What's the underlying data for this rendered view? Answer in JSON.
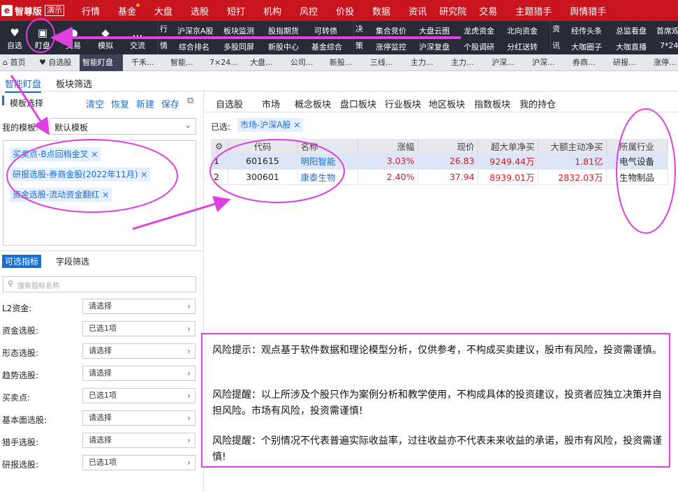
{
  "app": {
    "logo_mark": "e",
    "brand": "智尊版",
    "demo": "演示"
  },
  "top_menu": [
    "行情",
    "基金",
    "大盘",
    "选股",
    "短打",
    "机构",
    "风控",
    "价投",
    "数据",
    "资讯",
    "研究院",
    "交易",
    "主题猎手",
    "舆情猎手"
  ],
  "tool_buttons": [
    {
      "icon": "heart-icon",
      "glyph": "♥",
      "label": "自选"
    },
    {
      "icon": "chart-icon",
      "glyph": "▣",
      "label": "盯盘"
    },
    {
      "icon": "swap-icon",
      "glyph": "●",
      "label": "交易"
    },
    {
      "icon": "gamepad-icon",
      "glyph": "◆",
      "label": "模拟"
    },
    {
      "icon": "chat-icon",
      "glyph": "…",
      "label": "交流"
    }
  ],
  "groups": {
    "hang_label": "行情",
    "hang_row1": [
      "沪深京A股",
      "板块监测",
      "股指期货",
      "可转债"
    ],
    "hang_row2": [
      "综合排名",
      "多股同屏",
      "新股中心",
      "基金综合"
    ],
    "jue_label": "决策",
    "jue_row1": [
      "集合竞价",
      "大盘云图",
      "龙虎资金",
      "北向资金"
    ],
    "jue_row2": [
      "涨停监控",
      "沪深复盘",
      "个股调研",
      "分红送转"
    ],
    "zi_label": "资讯",
    "zi_row1": [
      "经传头条",
      "总监看盘",
      "首席观"
    ],
    "zi_row2": [
      "大咖圈子",
      "大咖直播",
      "7*24"
    ]
  },
  "tabs": [
    "首页",
    "自选股",
    "智能盯盘",
    "千禾...",
    "智能...",
    "7×24...",
    "大盘...",
    "公司...",
    "新股...",
    "三线...",
    "主力...",
    "主力...",
    "沪深...",
    "沪深...",
    "券商...",
    "研报...",
    "涨停..."
  ],
  "sub_tabs": {
    "smart": "智能盯盘",
    "sector": "板块筛选"
  },
  "left_panel": {
    "template_select": "模板选择",
    "actions": [
      "清空",
      "恢复",
      "新建",
      "保存"
    ],
    "my_template_label": "我的模板:",
    "my_template_value": "默认模板",
    "selected_tags": [
      "买卖点-B点回档金叉",
      "研报选股-券商金股(2022年11月)",
      "资金选股-流动资金翻红"
    ],
    "indicator_tabs": [
      "可选指标",
      "字段筛选"
    ],
    "search_placeholder": "搜索指标名称",
    "indicators": [
      {
        "label": "L2资金:",
        "value": "请选择"
      },
      {
        "label": "资金选股:",
        "value": "已选1项"
      },
      {
        "label": "形态选股:",
        "value": "请选择"
      },
      {
        "label": "趋势选股:",
        "value": "请选择"
      },
      {
        "label": "买卖点:",
        "value": "已选1项"
      },
      {
        "label": "基本面选股:",
        "value": "请选择"
      },
      {
        "label": "猎手选股:",
        "value": "请选择"
      },
      {
        "label": "研报选股:",
        "value": "已选1项"
      }
    ]
  },
  "right_tabs": [
    "自选股",
    "市场",
    "概念板块",
    "盘口板块",
    "行业板块",
    "地区板块",
    "指数板块",
    "我的持仓"
  ],
  "filter": {
    "label": "已选:",
    "chip": "市场-沪深A股"
  },
  "table": {
    "headers": [
      "代码",
      "名称",
      "涨幅",
      "现价",
      "超大单净买",
      "大额主动净买",
      "所属行业"
    ],
    "rows": [
      {
        "idx": "1",
        "code": "601615",
        "name": "明阳智能",
        "change": "3.03%",
        "price": "26.83",
        "super": "9249.44万",
        "big": "1.81亿",
        "industry": "电气设备"
      },
      {
        "idx": "2",
        "code": "300601",
        "name": "康泰生物",
        "change": "2.40%",
        "price": "37.94",
        "super": "8939.01万",
        "big": "2832.03万",
        "industry": "生物制品"
      }
    ]
  },
  "risk": [
    "风险提示：观点基于软件数据和理论模型分析，仅供参考，不构成买卖建议，股市有风险，投资需谨慎。",
    "风险提醒：以上所涉及个股只作为案例分析和教学使用，不构成具体的投资建议，投资者应独立决策并自担风险。市场有风险，投资需谨慎!",
    "风险提醒：个别情况不代表普遍实际收益率，过往收益亦不代表未来收益的承诺，股市有风险，投资需谨慎!"
  ],
  "colors": {
    "brand_red": "#c8141e",
    "toolbar": "#272b38",
    "accent_blue": "#1c6fd1",
    "annotation": "#e040e0",
    "up_red": "#e0141a"
  }
}
